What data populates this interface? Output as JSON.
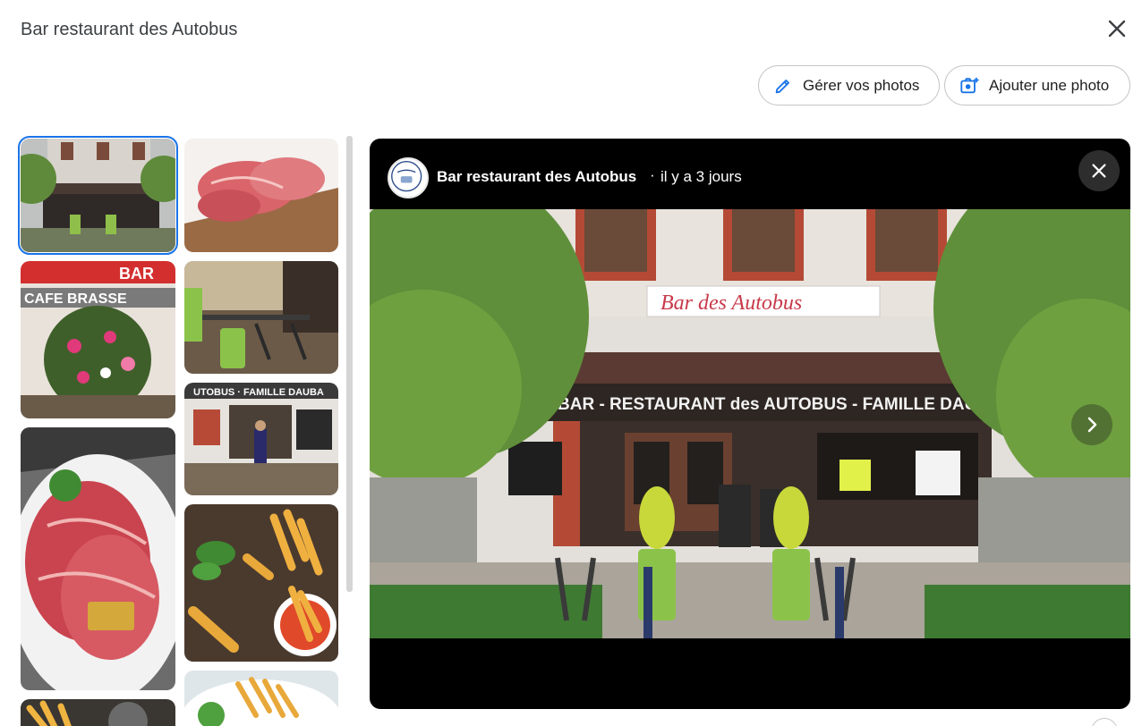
{
  "header": {
    "title": "Bar restaurant des Autobus",
    "close_icon": "close-icon"
  },
  "actions": {
    "manage_label": "Gérer vos photos",
    "manage_icon": "pencil-icon",
    "add_label": "Ajouter une photo",
    "add_icon": "add-photo-icon"
  },
  "gallery": {
    "thumbnails": [
      {
        "subject": "restaurant storefront",
        "selected": true
      },
      {
        "subject": "sliced ham on wooden board"
      },
      {
        "subject": "Café Brasserie sign with flower basket"
      },
      {
        "subject": "terrace with tables and green planter"
      },
      {
        "subject": "storefront with person standing"
      },
      {
        "subject": "ham plate with butter"
      },
      {
        "subject": "fries with herbs and sauce"
      },
      {
        "subject": "fries"
      },
      {
        "subject": "steak and fries"
      }
    ]
  },
  "viewer": {
    "author": "Bar restaurant des Autobus",
    "separator": "·",
    "time": "il y a 3 jours",
    "close_icon": "close-icon",
    "next_icon": "chevron-right-icon"
  },
  "colors": {
    "accent": "#1a73e8",
    "viewer_bg": "#000000",
    "pill_border": "#c4c7c5"
  }
}
